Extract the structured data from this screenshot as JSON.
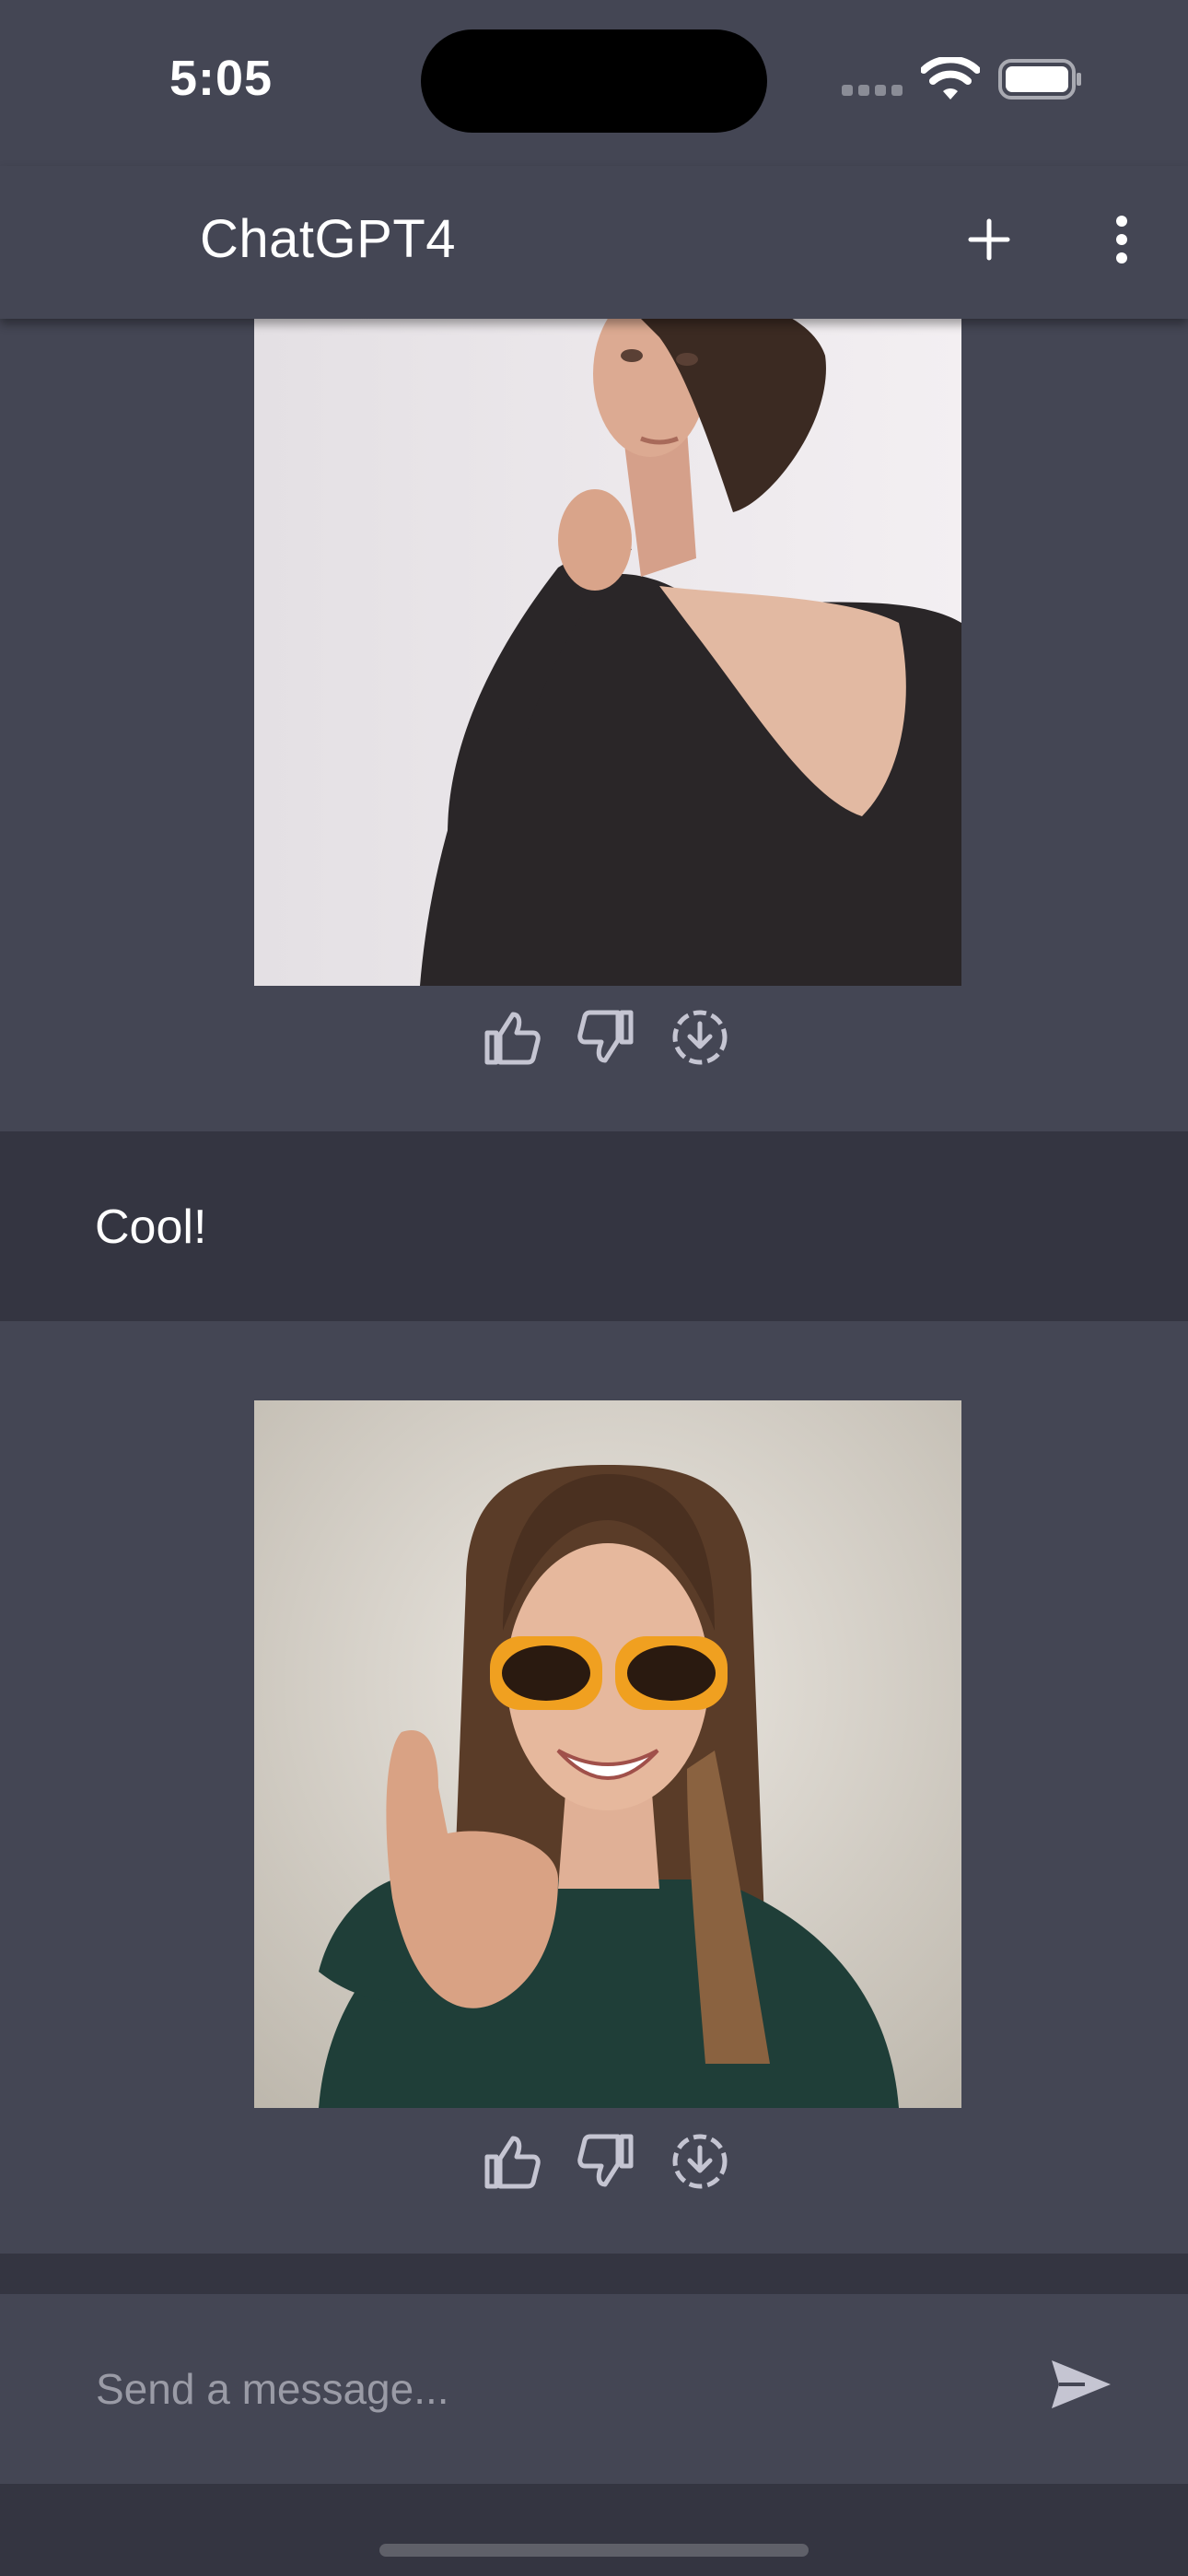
{
  "status_bar": {
    "time": "5:05"
  },
  "header": {
    "title": "ChatGPT4"
  },
  "messages": [
    {
      "role": "assistant",
      "type": "image",
      "image_desc": "portrait of a woman in black dress",
      "actions": [
        "thumbs-up",
        "thumbs-down",
        "download"
      ]
    },
    {
      "role": "user",
      "type": "text",
      "text": "Cool!"
    },
    {
      "role": "assistant",
      "type": "image",
      "image_desc": "smiling woman with sunglasses giving thumbs up",
      "actions": [
        "thumbs-up",
        "thumbs-down",
        "download"
      ]
    }
  ],
  "input": {
    "placeholder": "Send a message..."
  },
  "colors": {
    "assistant_bg": "#444654",
    "user_bg": "#343541",
    "text": "#ffffff",
    "icon_gray": "#c5c5d2"
  }
}
